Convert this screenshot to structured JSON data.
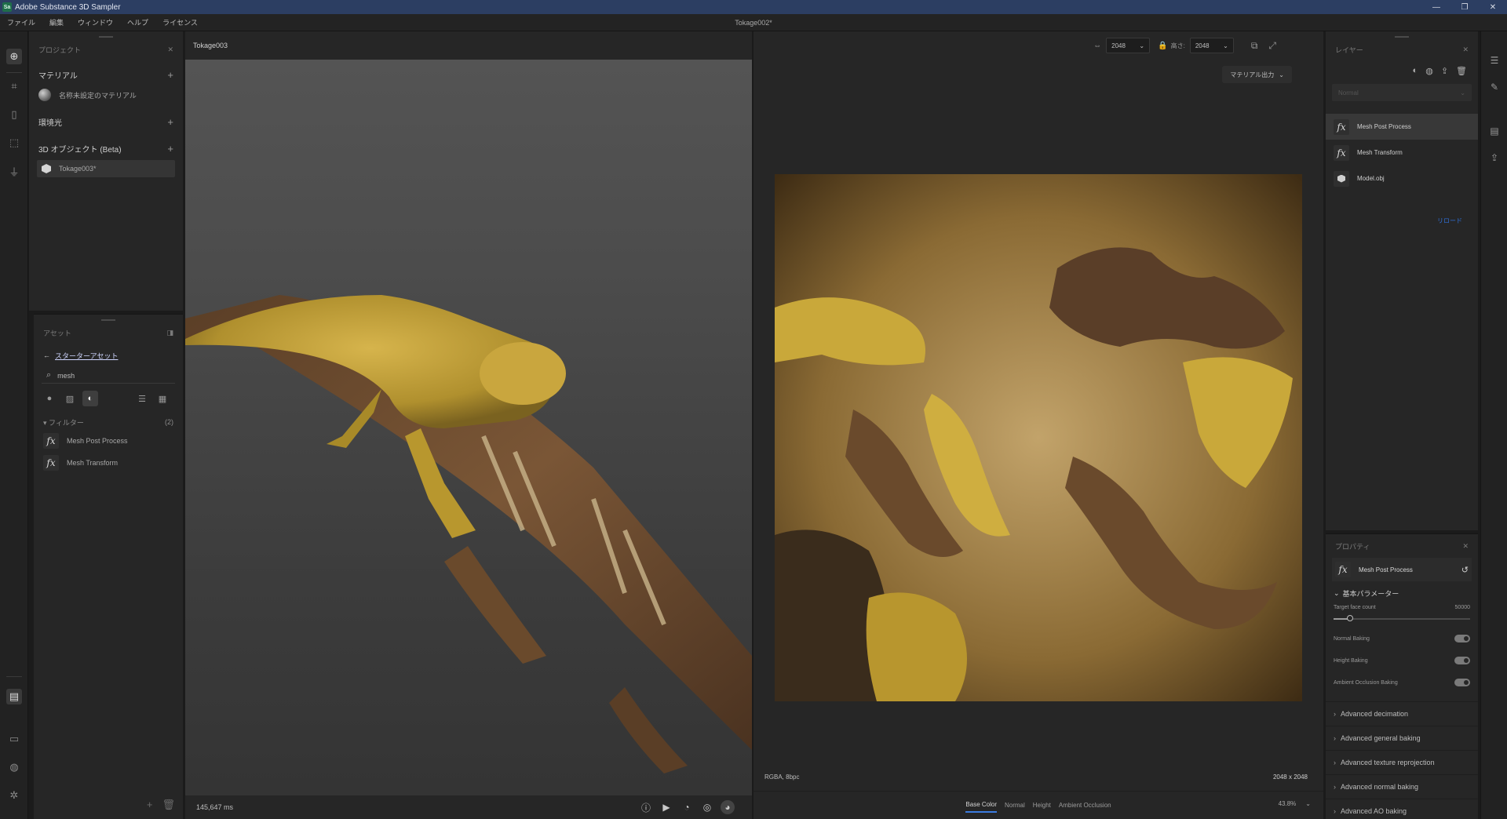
{
  "titlebar": {
    "logo": "Sa",
    "title": "Adobe Substance 3D Sampler",
    "minimize": "—",
    "maximize": "❐",
    "close": "✕"
  },
  "menu": {
    "items": [
      "ファイル",
      "編集",
      "ウィンドウ",
      "ヘルプ",
      "ライセンス"
    ]
  },
  "document_title": "Tokage002*",
  "left_tools": [
    "plus-circle-icon",
    "crop-icon",
    "patch-icon",
    "transform-icon",
    "stamp-icon"
  ],
  "left_tools_bottom": [
    "assets-icon",
    "comment-icon",
    "materials-icon",
    "settings-icon"
  ],
  "project": {
    "title": "プロジェクト",
    "close": "✕",
    "materials_label": "マテリアル",
    "material_item": "名称未設定のマテリアル",
    "environment_label": "環境光",
    "objects_label": "3D オブジェクト (Beta)",
    "object_item": "Tokage003*",
    "add": "+"
  },
  "assets": {
    "title": "アセット",
    "back_label": "スターターアセット",
    "search_value": "mesh",
    "filter_label": "フィルター",
    "filter_count": "(2)",
    "items": [
      "Mesh Post Process",
      "Mesh Transform"
    ],
    "fx_glyph": "fx"
  },
  "viewport": {
    "tab_label": "Tokage003",
    "timing": "145,647 ms"
  },
  "view2d": {
    "width_value": "2048",
    "height_label": "高さ:",
    "height_value": "2048",
    "export_label": "マテリアル出力",
    "format": "RGBA, 8bpc",
    "resolution": "2048 x 2048",
    "channels": [
      "Base Color",
      "Normal",
      "Height",
      "Ambient Occlusion"
    ],
    "active_channel": "Base Color",
    "zoom": "43.8%"
  },
  "layers": {
    "title": "レイヤー",
    "blend_mode": "Normal",
    "items": [
      {
        "label": "Mesh Post Process",
        "kind": "fx"
      },
      {
        "label": "Mesh Transform",
        "kind": "fx"
      },
      {
        "label": "Model.obj",
        "kind": "object"
      }
    ],
    "reload": "リロード"
  },
  "properties": {
    "title": "プロパティ",
    "layer_name": "Mesh Post Process",
    "section": "基本パラメーター",
    "target_face_label": "Target face count",
    "target_face_value": "50000",
    "target_face_fraction": 0.12,
    "toggles": [
      {
        "label": "Normal Baking",
        "on": true
      },
      {
        "label": "Height Baking",
        "on": true
      },
      {
        "label": "Ambient Occlusion Baking",
        "on": true
      }
    ],
    "collapsed": [
      "Advanced decimation",
      "Advanced general baking",
      "Advanced texture reprojection",
      "Advanced normal baking",
      "Advanced AO baking"
    ]
  },
  "colors": {
    "accent": "#3b7be0",
    "titlebar": "#2c3e62",
    "panel": "#262626"
  }
}
